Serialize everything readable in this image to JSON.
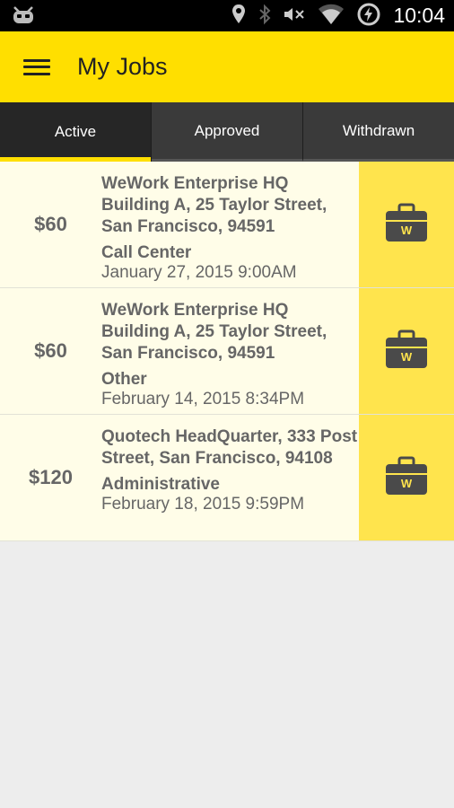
{
  "statusbar": {
    "time": "10:04",
    "icons": [
      "android-robot-icon",
      "location-icon",
      "bluetooth-icon",
      "mute-icon",
      "wifi-icon",
      "battery-charging-icon"
    ]
  },
  "toolbar": {
    "title": "My Jobs",
    "menu_icon": "hamburger-menu-icon"
  },
  "colors": {
    "accent": "#ffdf00",
    "action_bg": "#ffe44d",
    "row_bg": "#fffde8",
    "tab_bg": "#2f2f2f"
  },
  "tabs": [
    {
      "label": "Active",
      "selected": true
    },
    {
      "label": "Approved",
      "selected": false
    },
    {
      "label": "Withdrawn",
      "selected": false
    }
  ],
  "jobs": [
    {
      "price": "$60",
      "address": "WeWork Enterprise HQ Building A, 25 Taylor Street, San Francisco, 94591",
      "category": "Call Center",
      "date": "January 27, 2015 9:00AM",
      "action_icon": "briefcase-icon"
    },
    {
      "price": "$60",
      "address": "WeWork Enterprise HQ Building A, 25 Taylor Street, San Francisco, 94591",
      "category": "Other",
      "date": "February 14, 2015 8:34PM",
      "action_icon": "briefcase-icon"
    },
    {
      "price": "$120",
      "address": "Quotech HeadQuarter, 333 Post Street, San Francisco, 94108",
      "category": "Administrative",
      "date": "February 18, 2015 9:59PM",
      "action_icon": "briefcase-icon"
    }
  ]
}
